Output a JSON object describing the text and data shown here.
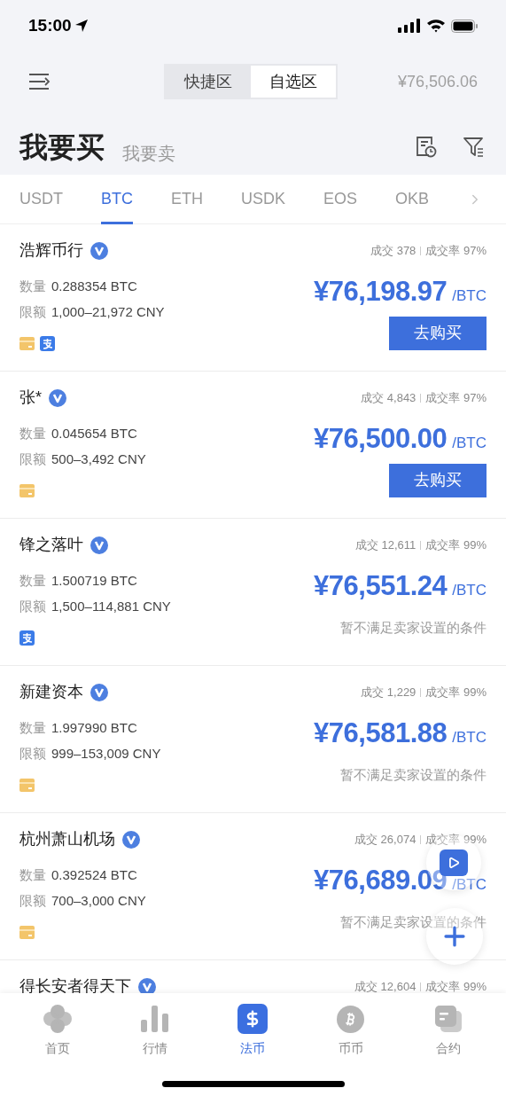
{
  "status_bar": {
    "time": "15:00"
  },
  "nav": {
    "segments": [
      {
        "label": "快捷区",
        "selected": false
      },
      {
        "label": "自选区",
        "selected": true
      }
    ],
    "index_price": "¥76,506.06"
  },
  "trade_sides": [
    {
      "label": "我要买",
      "selected": true
    },
    {
      "label": "我要卖",
      "selected": false
    }
  ],
  "currency_tabs": [
    {
      "label": "USDT",
      "selected": false
    },
    {
      "label": "BTC",
      "selected": true
    },
    {
      "label": "ETH",
      "selected": false
    },
    {
      "label": "USDK",
      "selected": false
    },
    {
      "label": "EOS",
      "selected": false
    },
    {
      "label": "OKB",
      "selected": false
    }
  ],
  "offers": [
    {
      "name": "浩辉币行",
      "verified": true,
      "trades": "成交 378",
      "rate": "成交率 97%",
      "qty_label": "数量",
      "qty": "0.288354 BTC",
      "limit_label": "限额",
      "limit": "1,000–21,972 CNY",
      "payments": [
        {
          "kind": "card"
        },
        {
          "kind": "alipay"
        }
      ],
      "price": "¥76,198.97",
      "unit": "/BTC",
      "action": {
        "kind": "button",
        "label": "去购买"
      }
    },
    {
      "name": "张*",
      "verified": true,
      "trades": "成交 4,843",
      "rate": "成交率 97%",
      "qty_label": "数量",
      "qty": "0.045654 BTC",
      "limit_label": "限额",
      "limit": "500–3,492 CNY",
      "payments": [
        {
          "kind": "card"
        }
      ],
      "price": "¥76,500.00",
      "unit": "/BTC",
      "action": {
        "kind": "button",
        "label": "去购买"
      }
    },
    {
      "name": "锋之落叶",
      "verified": true,
      "trades": "成交 12,611",
      "rate": "成交率 99%",
      "qty_label": "数量",
      "qty": "1.500719 BTC",
      "limit_label": "限额",
      "limit": "1,500–114,881 CNY",
      "payments": [
        {
          "kind": "alipay"
        }
      ],
      "price": "¥76,551.24",
      "unit": "/BTC",
      "action": {
        "kind": "note",
        "label": "暂不满足卖家设置的条件"
      }
    },
    {
      "name": "新建资本",
      "verified": true,
      "trades": "成交 1,229",
      "rate": "成交率 99%",
      "qty_label": "数量",
      "qty": "1.997990 BTC",
      "limit_label": "限额",
      "limit": "999–153,009 CNY",
      "payments": [
        {
          "kind": "card"
        }
      ],
      "price": "¥76,581.88",
      "unit": "/BTC",
      "action": {
        "kind": "note",
        "label": "暂不满足卖家设置的条件"
      }
    },
    {
      "name": "杭州萧山机场",
      "verified": true,
      "trades": "成交 26,074",
      "rate": "成交率 99%",
      "qty_label": "数量",
      "qty": "0.392524 BTC",
      "limit_label": "限额",
      "limit": "700–3,000 CNY",
      "payments": [
        {
          "kind": "card"
        }
      ],
      "price": "¥76,689.09",
      "unit": "/BTC",
      "action": {
        "kind": "note",
        "label": "暂不满足卖家设置的条件"
      }
    },
    {
      "name": "得长安者得天下",
      "verified": true,
      "trades": "成交 12,604",
      "rate": "成交率 99%"
    }
  ],
  "bottom_tabs": [
    {
      "kind": "home",
      "label": "首页",
      "selected": false
    },
    {
      "kind": "market",
      "label": "行情",
      "selected": false
    },
    {
      "kind": "fiat",
      "label": "法币",
      "selected": true
    },
    {
      "kind": "spot",
      "label": "币币",
      "selected": false
    },
    {
      "kind": "futures",
      "label": "合约",
      "selected": false
    }
  ]
}
